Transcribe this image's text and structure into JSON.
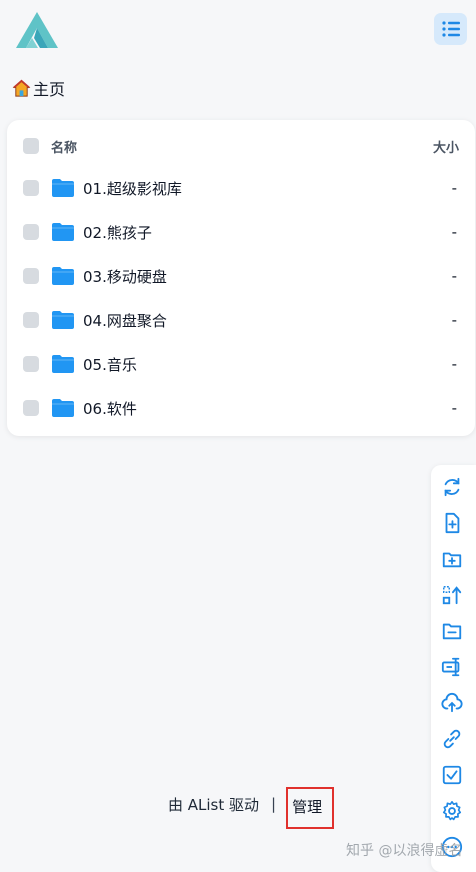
{
  "breadcrumb": {
    "home_label": "主页"
  },
  "list": {
    "header": {
      "name": "名称",
      "size": "大小"
    },
    "rows": [
      {
        "name": "01.超级影视库",
        "size": "-"
      },
      {
        "name": "02.熊孩子",
        "size": "-"
      },
      {
        "name": "03.移动硬盘",
        "size": "-"
      },
      {
        "name": "04.网盘聚合",
        "size": "-"
      },
      {
        "name": "05.音乐",
        "size": "-"
      },
      {
        "name": "06.软件",
        "size": "-"
      }
    ]
  },
  "toolbar": {
    "icons": [
      "refresh-icon",
      "new-file-icon",
      "new-folder-icon",
      "sort-icon",
      "folder-minus-icon",
      "rename-icon",
      "upload-icon",
      "link-icon",
      "checkbox-icon",
      "settings-icon",
      "more-icon"
    ]
  },
  "footer": {
    "powered_by": "由 AList 驱动",
    "separator": "|",
    "manage": "管理"
  },
  "watermark": "知乎 @以浪得虚名",
  "colors": {
    "accent": "#1e88e5",
    "folder": "#2196f3",
    "highlight_border": "#e0312d"
  }
}
